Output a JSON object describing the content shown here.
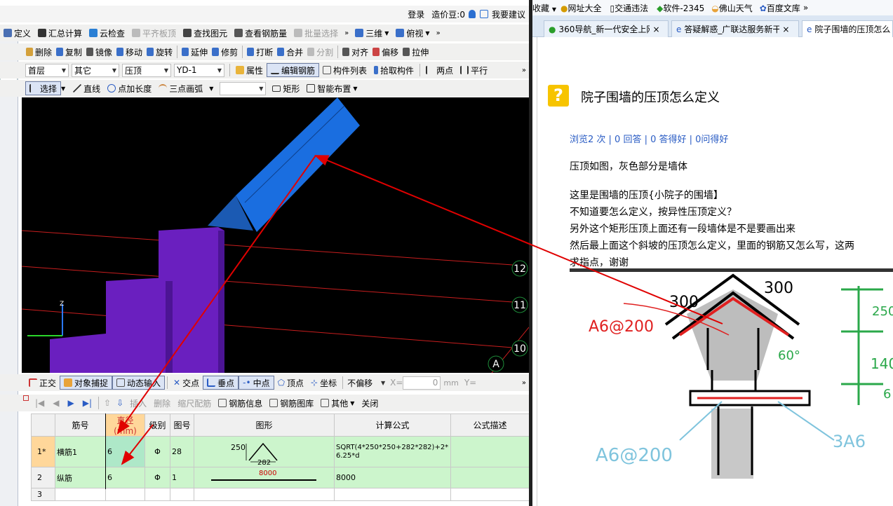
{
  "app": {
    "top": {
      "login": "登录",
      "beans": "造价豆:0",
      "suggest": "我要建议"
    },
    "main_toolbar": [
      {
        "label": "定义",
        "icon": "define-icon",
        "disabled": false
      },
      {
        "label": "汇总计算",
        "icon": "sigma-icon",
        "disabled": false
      },
      {
        "label": "云检查",
        "icon": "cloud-check-icon",
        "disabled": false
      },
      {
        "label": "平齐板顶",
        "icon": "align-slab-icon",
        "disabled": true
      },
      {
        "label": "查找图元",
        "icon": "binoculars-icon",
        "disabled": false
      },
      {
        "label": "查看钢筋量",
        "icon": "rebar-view-icon",
        "disabled": false
      },
      {
        "label": "批量选择",
        "icon": "batch-select-icon",
        "disabled": true
      }
    ],
    "view_mode": "三维",
    "view_dir": "俯视",
    "edit_toolbar": [
      {
        "label": "删除",
        "icon": "eraser-icon"
      },
      {
        "label": "复制",
        "icon": "copy-icon"
      },
      {
        "label": "镜像",
        "icon": "mirror-icon"
      },
      {
        "label": "移动",
        "icon": "move-icon"
      },
      {
        "label": "旋转",
        "icon": "rotate-icon"
      },
      {
        "label": "延伸",
        "icon": "extend-icon"
      },
      {
        "label": "修剪",
        "icon": "trim-icon"
      },
      {
        "label": "打断",
        "icon": "break-icon"
      },
      {
        "label": "合并",
        "icon": "merge-icon"
      },
      {
        "label": "分割",
        "icon": "split-icon",
        "disabled": true
      },
      {
        "label": "对齐",
        "icon": "align-icon"
      },
      {
        "label": "偏移",
        "icon": "offset-icon"
      },
      {
        "label": "拉伸",
        "icon": "stretch-icon"
      }
    ],
    "floor": "首层",
    "category": "其它",
    "component_type": "压顶",
    "component_name": "YD-1",
    "props_toolbar": {
      "attr": "属性",
      "edit_rebar": "编辑钢筋",
      "comp_list": "构件列表",
      "pick": "拾取构件",
      "two_points": "两点",
      "parallel": "平行"
    },
    "draw_toolbar": {
      "select": "选择",
      "line": "直线",
      "add_len": "点加长度",
      "arc3": "三点画弧",
      "rect": "矩形",
      "smart": "智能布置"
    },
    "axis_labels": [
      "12",
      "11",
      "10",
      "A"
    ],
    "snap_toolbar": {
      "ortho": "正交",
      "osnap": "对象捕捉",
      "dyn": "动态输入",
      "intersect": "交点",
      "perp": "垂点",
      "mid": "中点",
      "vertex": "顶点",
      "coord": "坐标",
      "offset_mode": "不偏移",
      "x_label": "X=",
      "x_value": "0",
      "unit": "mm",
      "y_label": "Y="
    },
    "rebar_toolbar": {
      "insert": "插入",
      "delete": "删除",
      "scale": "缩尺配筋",
      "info": "钢筋信息",
      "lib": "钢筋图库",
      "other": "其他",
      "close": "关闭"
    },
    "grid": {
      "headers": [
        "筋号",
        "直径(mm)",
        "级别",
        "图号",
        "图形",
        "计算公式",
        "公式描述"
      ],
      "rows": [
        {
          "num": "1*",
          "name": "横筋1",
          "dia": "6",
          "grade": "Φ",
          "fig": "28",
          "shape": {
            "a": "250",
            "b": "282"
          },
          "formula": "SQRT(4*250*250+282*282)+2*6.25*d",
          "desc": ""
        },
        {
          "num": "2",
          "name": "纵筋",
          "dia": "6",
          "grade": "Φ",
          "fig": "1",
          "shape": {
            "len": "8000"
          },
          "formula": "8000",
          "desc": ""
        },
        {
          "num": "3",
          "name": "",
          "dia": "",
          "grade": "",
          "fig": "",
          "formula": "",
          "desc": ""
        }
      ]
    }
  },
  "browser": {
    "fav_bar": [
      {
        "label": "收藏",
        "icon": "star-icon"
      },
      {
        "label": "网址大全",
        "icon": "globe-icon"
      },
      {
        "label": "交通违法",
        "icon": "doc-icon"
      },
      {
        "label": "软件-2345",
        "icon": "soft-icon"
      },
      {
        "label": "佛山天气",
        "icon": "weather-icon"
      },
      {
        "label": "百度文库",
        "icon": "baidu-icon"
      }
    ],
    "tabs": [
      {
        "label": "360导航_新一代安全上网",
        "active": false
      },
      {
        "label": "答疑解惑_广联达服务新干",
        "active": false
      },
      {
        "label": "院子围墙的压顶怎么",
        "active": true
      }
    ],
    "question": {
      "title": "院子围墙的压顶怎么定义",
      "stats": "浏览2 次 | 0 回答 | 0 答得好 | 0问得好",
      "paragraphs": [
        "压顶如图，灰色部分是墙体",
        "这里是围墙的压顶{小院子的围墙】",
        "不知道要怎么定义，按异性压顶定义？",
        "另外这个矩形压顶上面还有一段墙体是不是要画出来",
        "然后最上面这个斜坡的压顶怎么定义，里面的钢筋又怎么写，这两",
        "求指点，谢谢"
      ]
    },
    "sketch": {
      "dim_left": "300",
      "dim_right": "300",
      "rebar_top": "A6@200",
      "rebar_mid": "A6@200",
      "rebar_right": "3A6",
      "angle": "60°",
      "heights": [
        "250",
        "140",
        "6"
      ]
    }
  }
}
